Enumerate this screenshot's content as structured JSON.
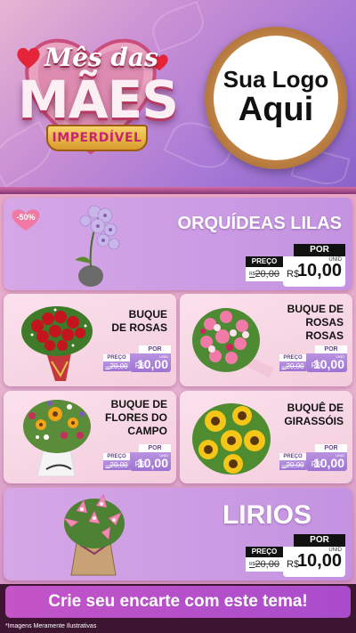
{
  "header": {
    "title_line1": "Mês das",
    "title_line2": "MÃES",
    "title_badge": "IMPERDÍVEL",
    "logo_line1": "Sua Logo",
    "logo_line2": "Aqui"
  },
  "products": [
    {
      "name": "ORQUÍDEAS LILAS",
      "discount": "-50%",
      "tag": {
        "preco": "PREÇO",
        "old_prefix": "R$",
        "old_price": "20,00",
        "por": "POR",
        "currency": "R$",
        "price": "10,00",
        "unit": "UNID"
      }
    },
    {
      "name": "BUQUE\nDE ROSAS",
      "tag": {
        "preco": "PREÇO",
        "old_prefix": "R$",
        "old_price": "20,00",
        "por": "POR",
        "currency": "R$",
        "price": "10,00",
        "unit": "UNID"
      }
    },
    {
      "name": "BUQUE DE\nROSAS\nROSAS",
      "tag": {
        "preco": "PREÇO",
        "old_prefix": "R$",
        "old_price": "20,00",
        "por": "POR",
        "currency": "R$",
        "price": "10,00",
        "unit": "UNID"
      }
    },
    {
      "name": "BUQUE DE\nFLORES DO\nCAMPO",
      "tag": {
        "preco": "PREÇO",
        "old_prefix": "R$",
        "old_price": "20,00",
        "por": "POR",
        "currency": "R$",
        "price": "10,00",
        "unit": "UNID"
      }
    },
    {
      "name": "BUQUÊ DE\nGIRASSÓIS",
      "tag": {
        "preco": "PREÇO",
        "old_prefix": "R$",
        "old_price": "20,00",
        "por": "POR",
        "currency": "R$",
        "price": "10,00",
        "unit": "UNID"
      }
    },
    {
      "name": "LIRIOS",
      "tag": {
        "preco": "PREÇO",
        "old_prefix": "R$",
        "old_price": "20,00",
        "por": "POR",
        "currency": "R$",
        "price": "10,00",
        "unit": "UNID"
      }
    }
  ],
  "footer": {
    "cta": "Crie seu encarte com este tema!",
    "disclaimer": "*Imagens Meramente Ilustrativas"
  },
  "colors": {
    "header_gradient_start": "#e7b6d2",
    "header_gradient_end": "#8a63c9",
    "title_pink": "#b83960",
    "badge_gold": "#f7d46a",
    "logo_ring": "#c98a4a",
    "card_lilac": "#c393e2",
    "card_pink": "#f3cddd",
    "cta_purple": "#b050c9",
    "footer_bg": "#3d1530"
  }
}
